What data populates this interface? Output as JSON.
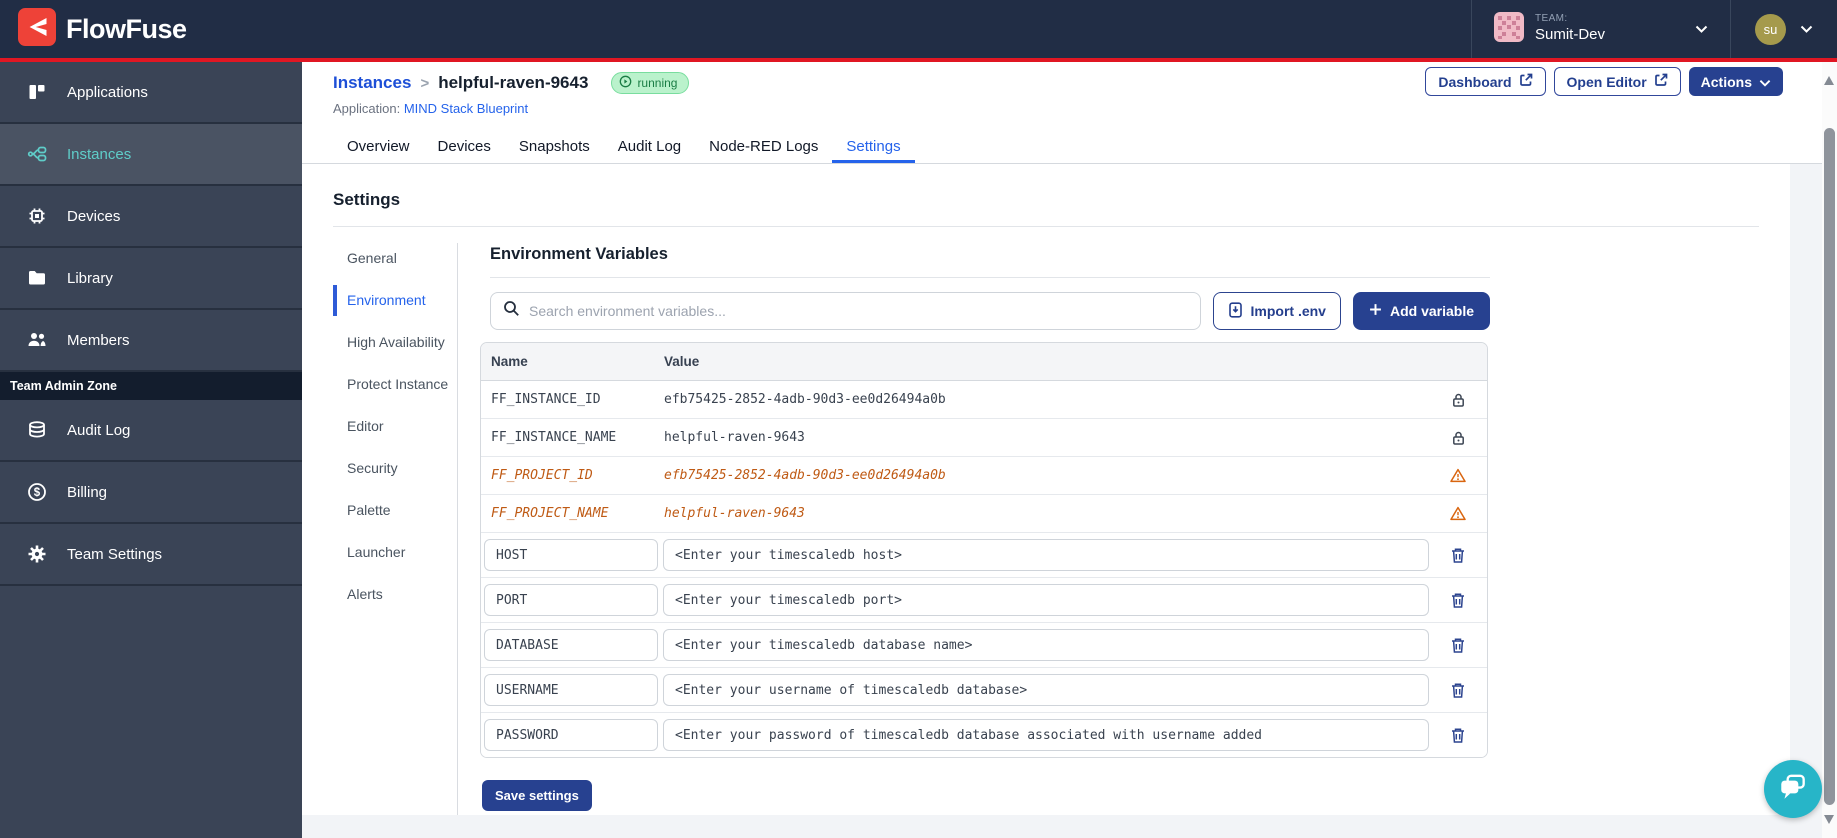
{
  "topbar": {
    "brand": "FlowFuse",
    "team_label": "TEAM:",
    "team_name": "Sumit-Dev",
    "user_initials": "su"
  },
  "sidebar": {
    "items": [
      {
        "label": "Applications"
      },
      {
        "label": "Instances"
      },
      {
        "label": "Devices"
      },
      {
        "label": "Library"
      },
      {
        "label": "Members"
      }
    ],
    "admin_zone_label": "Team Admin Zone",
    "admin_items": [
      {
        "label": "Audit Log"
      },
      {
        "label": "Billing"
      },
      {
        "label": "Team Settings"
      }
    ]
  },
  "header": {
    "breadcrumb_parent": "Instances",
    "breadcrumb_sep": ">",
    "breadcrumb_current": "helpful-raven-9643",
    "status": "running",
    "application_label": "Application:",
    "application_name": "MIND Stack Blueprint",
    "dashboard_label": "Dashboard",
    "open_editor_label": "Open Editor",
    "actions_label": "Actions"
  },
  "tabs": [
    {
      "label": "Overview"
    },
    {
      "label": "Devices"
    },
    {
      "label": "Snapshots"
    },
    {
      "label": "Audit Log"
    },
    {
      "label": "Node-RED Logs"
    },
    {
      "label": "Settings"
    }
  ],
  "settings": {
    "title": "Settings",
    "subnav": [
      {
        "label": "General"
      },
      {
        "label": "Environment"
      },
      {
        "label": "High Availability"
      },
      {
        "label": "Protect Instance"
      },
      {
        "label": "Editor"
      },
      {
        "label": "Security"
      },
      {
        "label": "Palette"
      },
      {
        "label": "Launcher"
      },
      {
        "label": "Alerts"
      }
    ]
  },
  "env": {
    "title": "Environment Variables",
    "search_placeholder": "Search environment variables...",
    "import_label": "Import .env",
    "add_label": "Add variable",
    "headers": {
      "name": "Name",
      "value": "Value"
    },
    "rows": [
      {
        "type": "locked",
        "name": "FF_INSTANCE_ID",
        "value": "efb75425-2852-4adb-90d3-ee0d26494a0b"
      },
      {
        "type": "locked",
        "name": "FF_INSTANCE_NAME",
        "value": "helpful-raven-9643"
      },
      {
        "type": "warning",
        "name": "FF_PROJECT_ID",
        "value": "efb75425-2852-4adb-90d3-ee0d26494a0b"
      },
      {
        "type": "warning",
        "name": "FF_PROJECT_NAME",
        "value": "helpful-raven-9643"
      },
      {
        "type": "editable",
        "name": "HOST",
        "value": "<Enter your timescaledb host>"
      },
      {
        "type": "editable",
        "name": "PORT",
        "value": "<Enter your timescaledb port>"
      },
      {
        "type": "editable",
        "name": "DATABASE",
        "value": "<Enter your timescaledb database name>"
      },
      {
        "type": "editable",
        "name": "USERNAME",
        "value": "<Enter your username of timescaledb database>"
      },
      {
        "type": "editable",
        "name": "PASSWORD",
        "value": "<Enter your password of timescaledb database associated with username added"
      }
    ],
    "save_label": "Save settings"
  },
  "colors": {
    "topbar_navy": "#212d45",
    "accent_red": "#e01723",
    "brand_indigo": "#274190",
    "link_blue": "#2563eb",
    "sidebar_teal": "#5fcdc9",
    "status_green_text": "#1a7d45",
    "status_green_bg": "#baf2cc",
    "warning_orange": "#bf5a14",
    "chat_teal": "#27b5c8"
  }
}
